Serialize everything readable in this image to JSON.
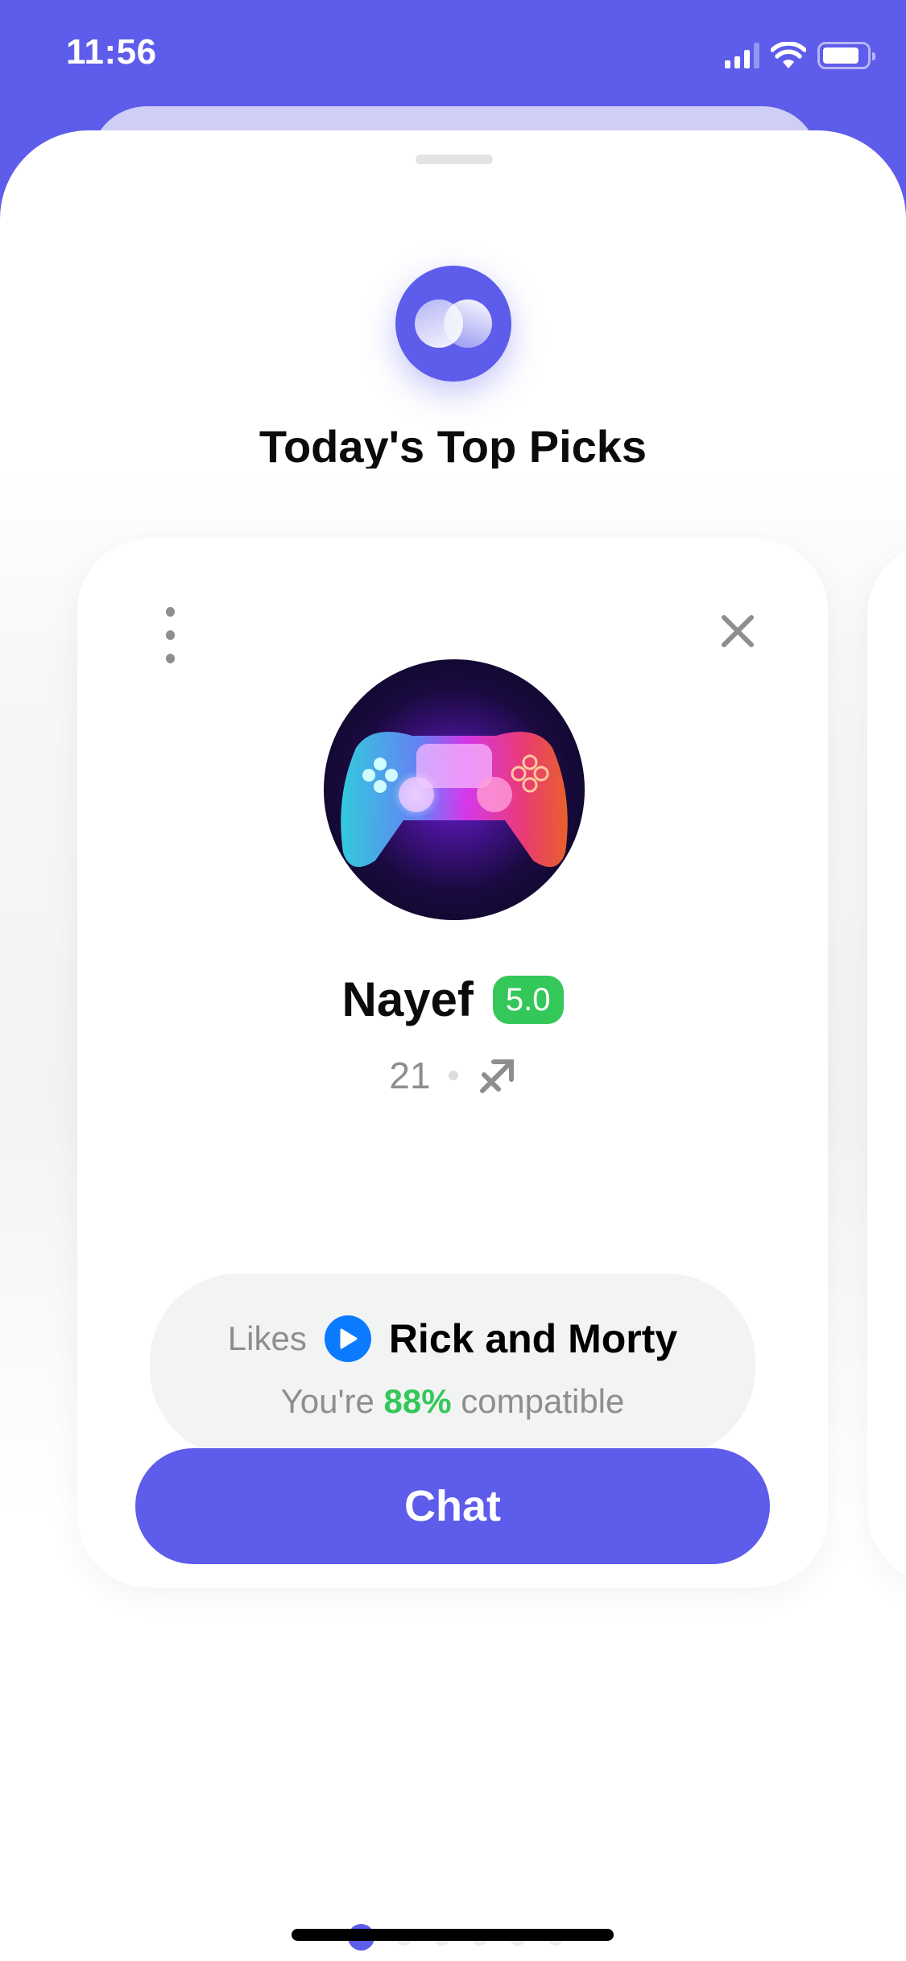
{
  "status_bar": {
    "time": "11:56",
    "icons": [
      "cellular-signal-icon",
      "wifi-icon",
      "battery-icon"
    ]
  },
  "header": {
    "logo_icon": "overlapping-circles-logo-icon",
    "title": "Today's Top Picks"
  },
  "card": {
    "more_icon": "more-vertical-icon",
    "close_icon": "close-icon",
    "avatar_description": "neon game controller artwork",
    "name": "Nayef",
    "rating": "5.0",
    "age": "21",
    "zodiac_icon": "sagittarius-icon",
    "likes_label": "Likes",
    "likes_icon": "play-icon",
    "likes_show": "Rick and Morty",
    "compat_prefix": "You're",
    "compat_percent": "88%",
    "compat_suffix": "compatible",
    "chat_label": "Chat"
  },
  "pagination": {
    "total": 6,
    "active_index": 0
  },
  "colors": {
    "accent": "#5D5CEB",
    "rating_green": "#34C759",
    "play_blue": "#0A7AFF"
  }
}
